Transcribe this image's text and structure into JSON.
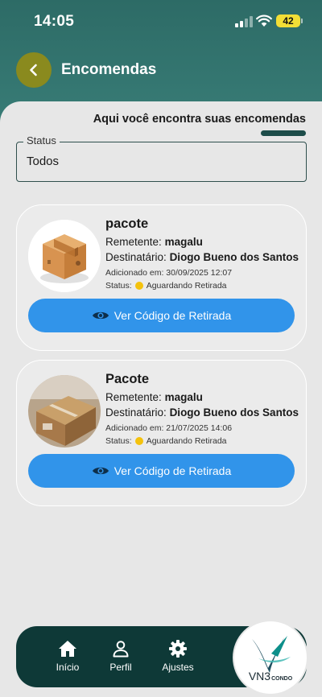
{
  "status_bar": {
    "time": "14:05",
    "battery": "42"
  },
  "header": {
    "title": "Encomendas"
  },
  "intro_text": "Aqui você encontra suas encomendas",
  "filter": {
    "legend": "Status",
    "value": "Todos"
  },
  "packages": [
    {
      "title": "pacote",
      "sender_label": "Remetente:",
      "sender": "magalu",
      "recipient_label": "Destinatário:",
      "recipient": "Diogo Bueno dos Santos",
      "added": "Adicionado em: 30/09/2025 12:07",
      "status_label": "Status:",
      "status": "Aguardando Retirada",
      "button": "Ver Código de Retirada"
    },
    {
      "title": "Pacote",
      "sender_label": "Remetente:",
      "sender": "magalu",
      "recipient_label": "Destinatário:",
      "recipient": "Diogo Bueno dos Santos",
      "added": "Adicionado em: 21/07/2025 14:06",
      "status_label": "Status:",
      "status": "Aguardando Retirada",
      "button": "Ver Código de Retirada"
    }
  ],
  "nav": {
    "items": [
      {
        "label": "Início",
        "icon": "home-icon"
      },
      {
        "label": "Perfil",
        "icon": "person-icon"
      },
      {
        "label": "Ajustes",
        "icon": "gear-icon"
      }
    ]
  },
  "logo": {
    "text": "VN3",
    "suffix": "CONDO"
  },
  "colors": {
    "header": "#2d6b66",
    "back_button": "#8a8a1e",
    "accent_button": "#3194ea",
    "nav_bg": "#0e3937",
    "status_dot": "#f4c20d"
  }
}
